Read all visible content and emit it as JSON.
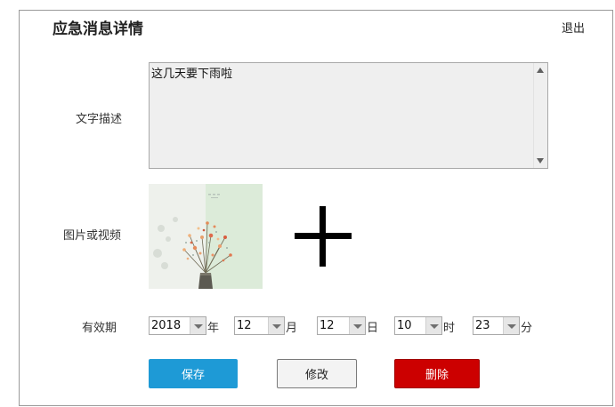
{
  "header": {
    "title": "应急消息详情",
    "exit_label": "退出"
  },
  "form": {
    "description_label": "文字描述",
    "description_value": "这几天要下雨啦",
    "media_label": "图片或视频",
    "validity_label": "有效期",
    "date": {
      "year": "2018",
      "year_unit": "年",
      "month": "12",
      "month_unit": "月",
      "day": "12",
      "day_unit": "日",
      "hour": "10",
      "hour_unit": "时",
      "minute": "23",
      "minute_unit": "分"
    }
  },
  "actions": {
    "save_label": "保存",
    "edit_label": "修改",
    "delete_label": "删除"
  },
  "colors": {
    "save": "#1e9ad6",
    "delete": "#cc0000"
  }
}
